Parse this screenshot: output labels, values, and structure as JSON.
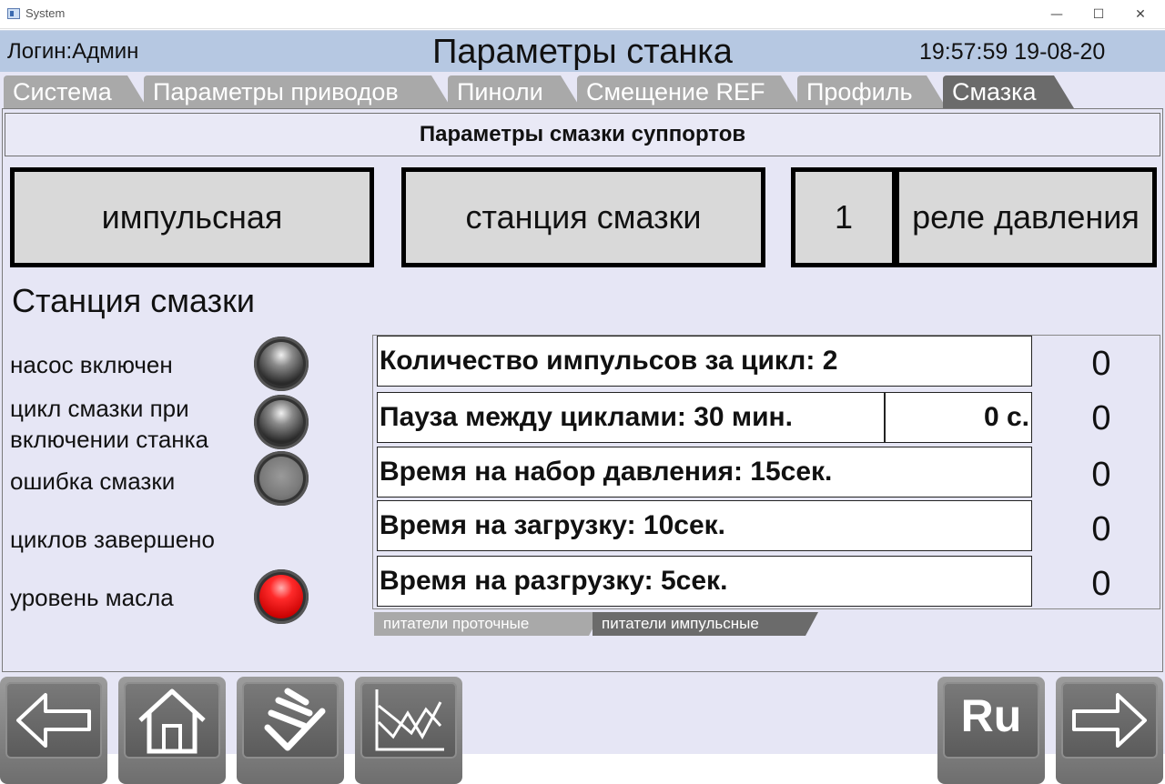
{
  "window": {
    "title": "System",
    "minimize_label": "—",
    "maximize_label": "☐",
    "close_label": "✕"
  },
  "header": {
    "login": "Логин:Админ",
    "page_title": "Параметры станка",
    "clock": "19:57:59 19-08-20"
  },
  "tabs": [
    {
      "label": "Система",
      "active": false
    },
    {
      "label": "Параметры приводов",
      "active": false
    },
    {
      "label": "Пиноли",
      "active": false
    },
    {
      "label": "Смещение REF",
      "active": false
    },
    {
      "label": "Профиль",
      "active": false
    },
    {
      "label": "Смазка",
      "active": true
    }
  ],
  "section": {
    "title": "Параметры смазки суппортов"
  },
  "mode_boxes": {
    "type": "импульсная",
    "source": "станция смазки",
    "count": "1",
    "sensor": "реле давления"
  },
  "station": {
    "title": "Станция смазки",
    "indicators": [
      {
        "label": "насос включен",
        "state": "on-grey"
      },
      {
        "label_line1": "цикл смазки при",
        "label_line2": "включении станка",
        "state": "on-grey"
      },
      {
        "label": "ошибка смазки",
        "state": "dim"
      },
      {
        "label": "циклов завершено",
        "state": "none"
      },
      {
        "label": "уровень масла",
        "state": "red"
      }
    ]
  },
  "params": [
    {
      "label": "Количество импульсов за цикл: 2",
      "value": "0"
    },
    {
      "label": "Пауза между циклами:  30 мин.",
      "extra": "0 с.",
      "value": "0"
    },
    {
      "label": "Время на набор давления: 15сек.",
      "value": "0"
    },
    {
      "label": "Время на загрузку: 10сек.",
      "value": "0"
    },
    {
      "label": "Время на разгрузку: 5сек.",
      "value": "0"
    }
  ],
  "subtabs": [
    {
      "label": "питатели проточные",
      "active": false
    },
    {
      "label": "питатели импульсные",
      "active": true
    }
  ],
  "nav": {
    "back_icon": "arrow-left-icon",
    "home_icon": "home-icon",
    "sign_icon": "signature-icon",
    "chart_icon": "chart-icon",
    "lang_label": "Ru",
    "forward_icon": "arrow-right-icon"
  },
  "colors": {
    "header_bg": "#b6c8e2",
    "tab_inactive": "#a9a9a9",
    "tab_active": "#6b6b6b",
    "panel_bg": "#e6e6f5",
    "lamp_red": "#ff2a2a"
  }
}
